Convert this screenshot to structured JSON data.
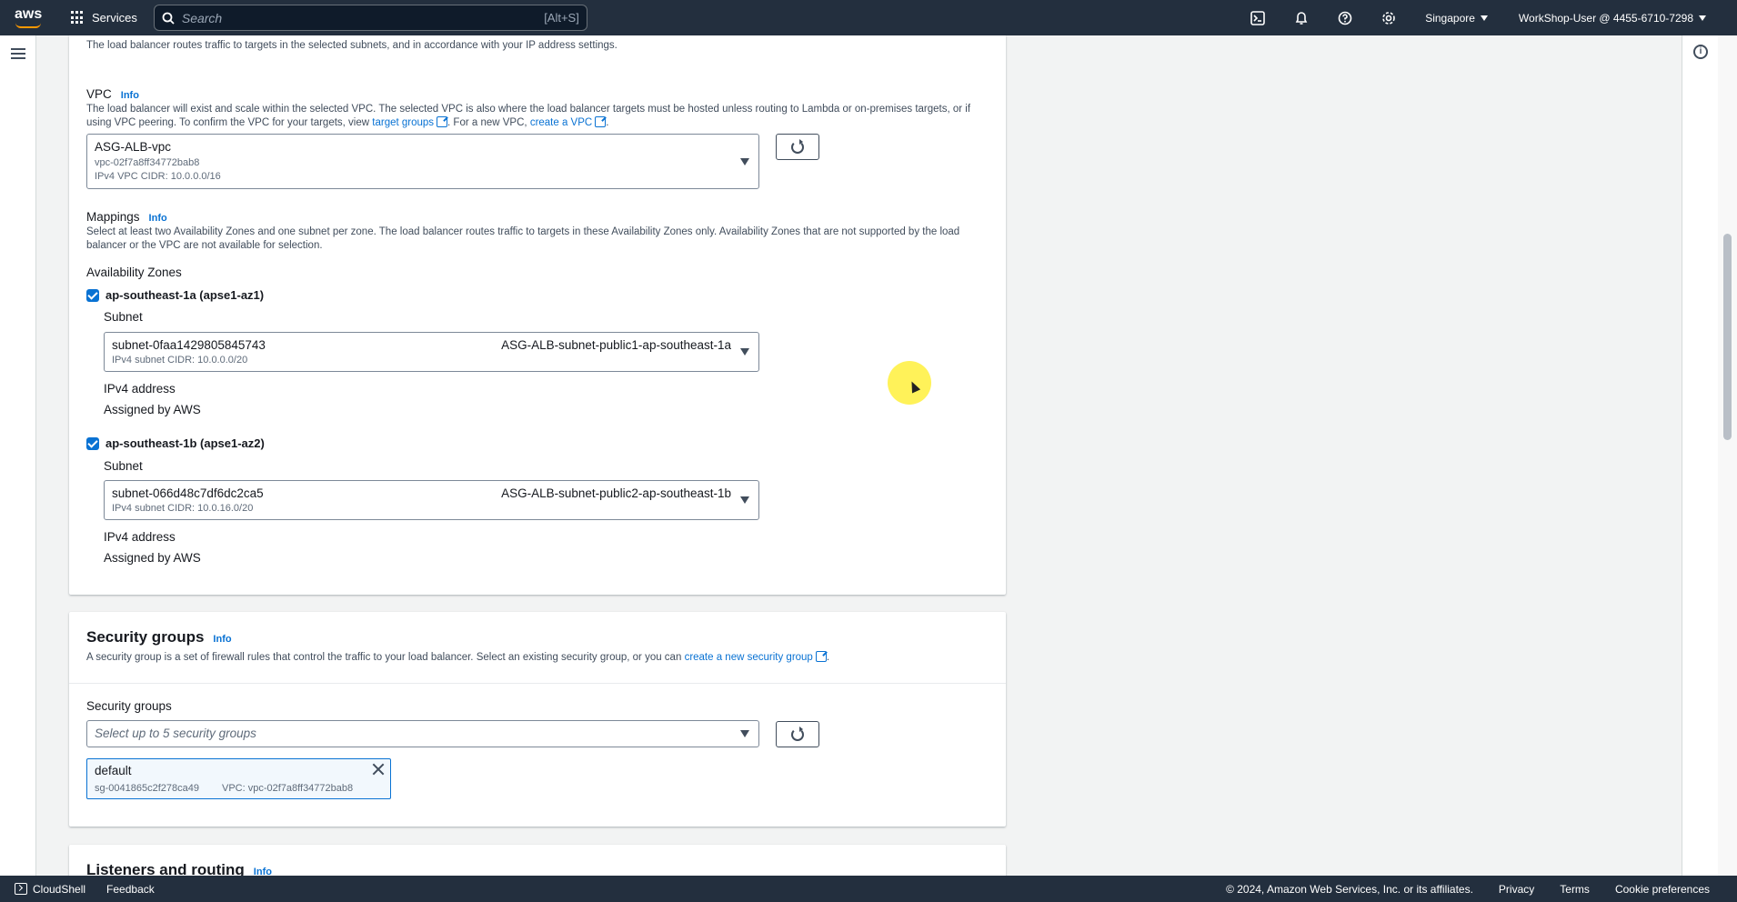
{
  "topnav": {
    "logo_text": "aws",
    "services_label": "Services",
    "search_placeholder": "Search",
    "search_shortcut": "[Alt+S]",
    "region": "Singapore",
    "account": "WorkShop-User @ 4455-6710-7298"
  },
  "network": {
    "intro": "The load balancer routes traffic to targets in the selected subnets, and in accordance with your IP address settings.",
    "vpc": {
      "label": "VPC",
      "info": "Info",
      "desc_part1": "The load balancer will exist and scale within the selected VPC. The selected VPC is also where the load balancer targets must be hosted unless routing to Lambda or on-premises targets, or if using VPC peering. To confirm the VPC for your targets, view",
      "link_target_groups": "target groups",
      "desc_part2": ". For a new VPC,",
      "link_create_vpc": "create a VPC",
      "desc_part3": ".",
      "selected_name": "ASG-ALB-vpc",
      "selected_id": "vpc-02f7a8ff34772bab8",
      "selected_cidr": "IPv4 VPC CIDR: 10.0.0.0/16"
    },
    "mappings": {
      "label": "Mappings",
      "info": "Info",
      "desc": "Select at least two Availability Zones and one subnet per zone. The load balancer routes traffic to targets in these Availability Zones only. Availability Zones that are not supported by the load balancer or the VPC are not available for selection.",
      "az_heading": "Availability Zones",
      "zones": [
        {
          "name": "ap-southeast-1a (apse1-az1)",
          "checked": true,
          "subnet_label": "Subnet",
          "subnet_id": "subnet-0faa1429805845743",
          "subnet_cidr": "IPv4 subnet CIDR: 10.0.0.0/20",
          "subnet_name": "ASG-ALB-subnet-public1-ap-southeast-1a",
          "ipv4_label": "IPv4 address",
          "ipv4_value": "Assigned by AWS"
        },
        {
          "name": "ap-southeast-1b (apse1-az2)",
          "checked": true,
          "subnet_label": "Subnet",
          "subnet_id": "subnet-066d48c7df6dc2ca5",
          "subnet_cidr": "IPv4 subnet CIDR: 10.0.16.0/20",
          "subnet_name": "ASG-ALB-subnet-public2-ap-southeast-1b",
          "ipv4_label": "IPv4 address",
          "ipv4_value": "Assigned by AWS"
        }
      ]
    }
  },
  "security_groups": {
    "title": "Security groups",
    "info": "Info",
    "desc_part1": "A security group is a set of firewall rules that control the traffic to your load balancer. Select an existing security group, or you can",
    "link_create": "create a new security group",
    "desc_part2": ".",
    "field_label": "Security groups",
    "placeholder": "Select up to 5 security groups",
    "selected": {
      "name": "default",
      "id": "sg-0041865c2f278ca49",
      "vpc": "VPC: vpc-02f7a8ff34772bab8"
    }
  },
  "listeners": {
    "title": "Listeners and routing",
    "info": "Info"
  },
  "footer": {
    "cloudshell": "CloudShell",
    "feedback": "Feedback",
    "copyright": "© 2024, Amazon Web Services, Inc. or its affiliates.",
    "privacy": "Privacy",
    "terms": "Terms",
    "cookies": "Cookie preferences"
  },
  "colors": {
    "nav_bg": "#232f3e",
    "link": "#0972d3",
    "accent": "#ff9900",
    "page_bg": "#f2f3f3"
  }
}
